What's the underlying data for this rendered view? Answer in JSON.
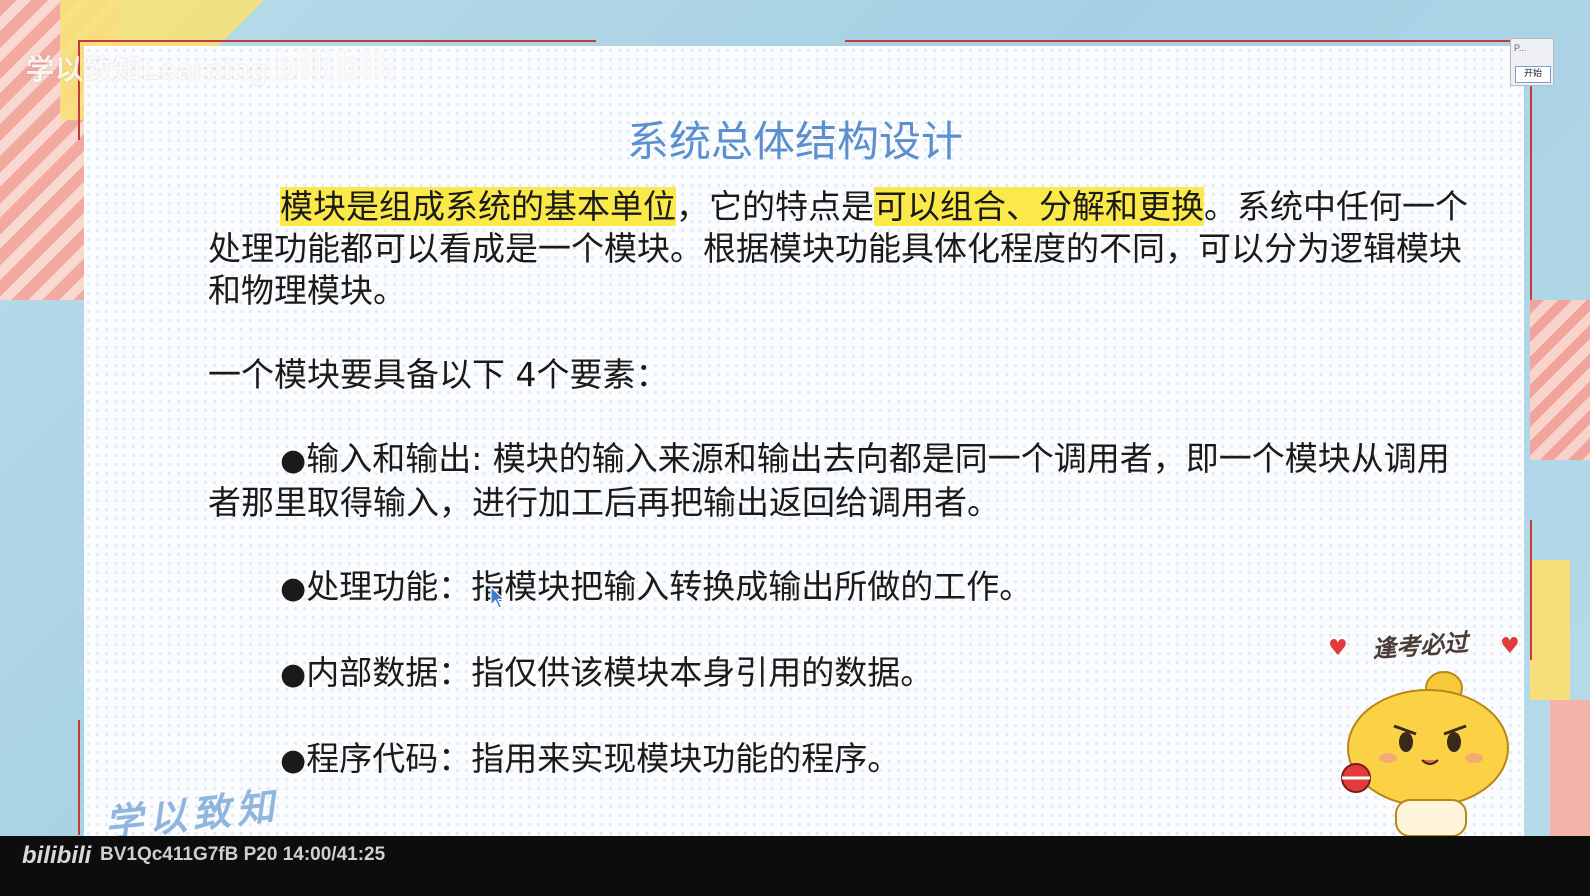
{
  "watermark": {
    "top_text": "学以致知Learning",
    "top_logo": "bilibili"
  },
  "slide": {
    "title": "系统总体结构设计",
    "para1": {
      "hl1": "模块是组成系统的基本单位",
      "mid": "，它的特点是",
      "hl2": "可以组合、分解和更换",
      "rest": "。系统中任何一个处理功能都可以看成是一个模块。根据模块功能具体化程度的不同，可以分为逻辑模块和物理模块。"
    },
    "intro": "一个模块要具备以下 4个要素：",
    "items": [
      {
        "bullet": "●",
        "text": "输入和输出: 模块的输入来源和输出去向都是同一个调用者，即一个模块从调用者那里取得输入，进行加工后再把输出返回给调用者。"
      },
      {
        "bullet": "●",
        "text": "处理功能：指模块把输入转换成输出所做的工作。"
      },
      {
        "bullet": "●",
        "text": "内部数据：指仅供该模块本身引用的数据。"
      },
      {
        "bullet": "●",
        "text": "程序代码：指用来实现模块功能的程序。"
      }
    ],
    "calligraphy": "学以致知",
    "sticker_text": "逢考必过"
  },
  "mini_window": {
    "label": "P...",
    "button": "开始"
  },
  "bottom_bar": {
    "logo": "bilibili",
    "video_info": "BV1Qc411G7fB P20 14:00/41:25"
  },
  "colors": {
    "title": "#5b8fcf",
    "highlight": "#fbe94a",
    "frame": "#c83a3a",
    "background": "#a9d3e6"
  }
}
